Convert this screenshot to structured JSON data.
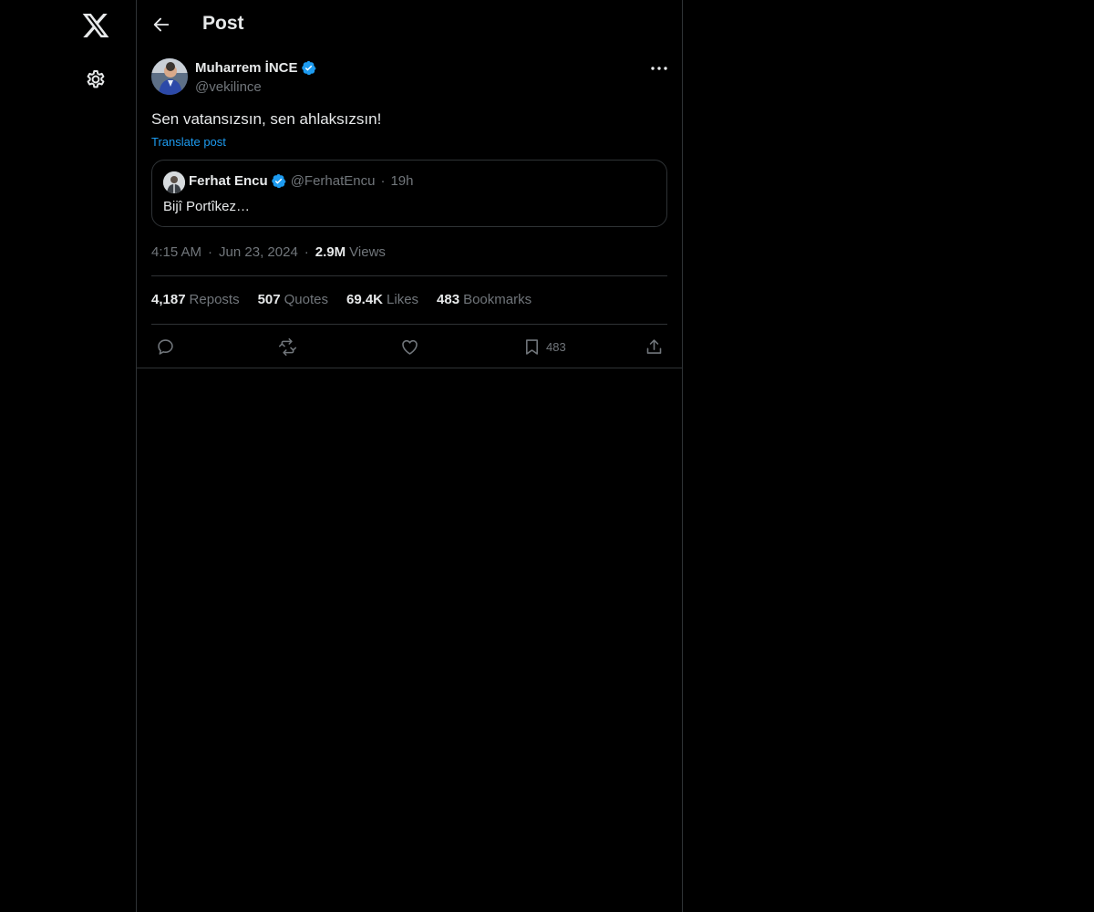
{
  "header": {
    "title": "Post"
  },
  "post": {
    "author_name": "Muharrem İNCE",
    "author_handle": "@vekilince",
    "text": "Sen vatansızsın, sen ahlaksızsın!",
    "translate_label": "Translate post",
    "time": "4:15 AM",
    "date": "Jun 23, 2024",
    "views_count": "2.9M",
    "views_label": "Views",
    "separator": "·"
  },
  "quote": {
    "name": "Ferhat Encu",
    "handle": "@FerhatEncu",
    "separator": "·",
    "time": "19h",
    "text": "Bijî Portîkez…"
  },
  "stats": {
    "reposts_count": "4,187",
    "reposts_label": "Reposts",
    "quotes_count": "507",
    "quotes_label": "Quotes",
    "likes_count": "69.4K",
    "likes_label": "Likes",
    "bookmarks_count": "483",
    "bookmarks_label": "Bookmarks"
  },
  "actions": {
    "bookmark_count": "483"
  },
  "icons": {
    "logo": "x-logo-icon",
    "settings": "gear-icon",
    "back": "arrow-left-icon",
    "more": "more-horizontal-icon",
    "verified": "verified-badge-icon",
    "reply": "reply-icon",
    "repost": "repost-icon",
    "like": "heart-icon",
    "bookmark": "bookmark-icon",
    "share": "share-icon"
  },
  "colors": {
    "background": "#000000",
    "text": "#e7e9ea",
    "muted": "#71767b",
    "accent": "#1d9bf0",
    "border": "#2f3336"
  }
}
